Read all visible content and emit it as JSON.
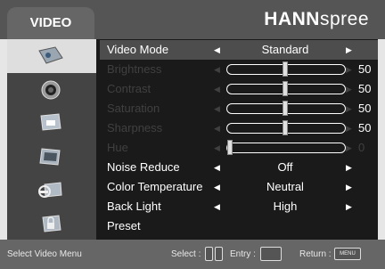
{
  "header": {
    "tab_title": "VIDEO",
    "brand_bold": "HANN",
    "brand_light": "spree"
  },
  "sidebar": {
    "items": [
      {
        "icon": "picture-icon",
        "selected": true
      },
      {
        "icon": "speaker-icon",
        "selected": false
      },
      {
        "icon": "display-icon",
        "selected": false
      },
      {
        "icon": "tv-icon",
        "selected": false
      },
      {
        "icon": "tools-icon",
        "selected": false
      },
      {
        "icon": "lock-icon",
        "selected": false
      }
    ]
  },
  "menu": {
    "rows": [
      {
        "label": "Video Mode",
        "type": "select",
        "value": "Standard",
        "selected": true,
        "enabled": true
      },
      {
        "label": "Brightness",
        "type": "slider",
        "value": "50",
        "level": 0.5,
        "enabled": false
      },
      {
        "label": "Contrast",
        "type": "slider",
        "value": "50",
        "level": 0.5,
        "enabled": false
      },
      {
        "label": "Saturation",
        "type": "slider",
        "value": "50",
        "level": 0.5,
        "enabled": false
      },
      {
        "label": "Sharpness",
        "type": "slider",
        "value": "50",
        "level": 0.5,
        "enabled": false
      },
      {
        "label": "Hue",
        "type": "slider",
        "value": "0",
        "level": 0.0,
        "enabled": false
      },
      {
        "label": "Noise Reduce",
        "type": "select",
        "value": "Off",
        "enabled": true
      },
      {
        "label": "Color Temperature",
        "type": "select",
        "value": "Neutral",
        "enabled": true
      },
      {
        "label": "Back Light",
        "type": "select",
        "value": "High",
        "enabled": true
      },
      {
        "label": "Preset",
        "type": "action",
        "value": "",
        "enabled": true
      }
    ]
  },
  "footer": {
    "hint": "Select Video Menu",
    "select_label": "Select :",
    "entry_label": "Entry :",
    "return_label": "Return :",
    "menu_key": "MENU"
  },
  "colors": {
    "header_bg": "#555555",
    "menu_bg": "#1a1a1a",
    "footer_bg": "#666666",
    "selected_row": "#4d4d4d"
  }
}
